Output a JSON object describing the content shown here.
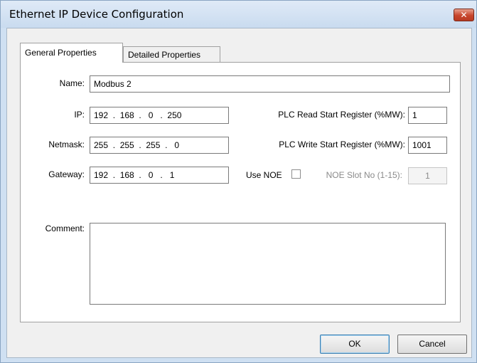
{
  "window": {
    "title": "Ethernet IP Device Configuration",
    "close_label": "✕"
  },
  "tabs": [
    {
      "label": "General Properties",
      "active": true
    },
    {
      "label": "Detailed Properties",
      "active": false
    }
  ],
  "form": {
    "name_label": "Name:",
    "name_value": "Modbus 2",
    "ip_label": "IP:",
    "ip_value": "192  .  168  .   0   .  250",
    "netmask_label": "Netmask:",
    "netmask_value": "255  .  255  .  255  .   0",
    "gateway_label": "Gateway:",
    "gateway_value": "192  .  168  .   0   .   1",
    "read_start_label": "PLC Read Start Register (%MW):",
    "read_start_value": "1",
    "write_start_label": "PLC Write Start Register (%MW):",
    "write_start_value": "1001",
    "use_noe_label": "Use NOE",
    "use_noe_checked": false,
    "noe_slot_label": "NOE Slot No (1-15):",
    "noe_slot_value": "1",
    "comment_label": "Comment:",
    "comment_value": ""
  },
  "buttons": {
    "ok": "OK",
    "cancel": "Cancel"
  },
  "colors": {
    "frame": "#cfe0f2",
    "close_button": "#c7452c",
    "panel": "#ffffff"
  }
}
